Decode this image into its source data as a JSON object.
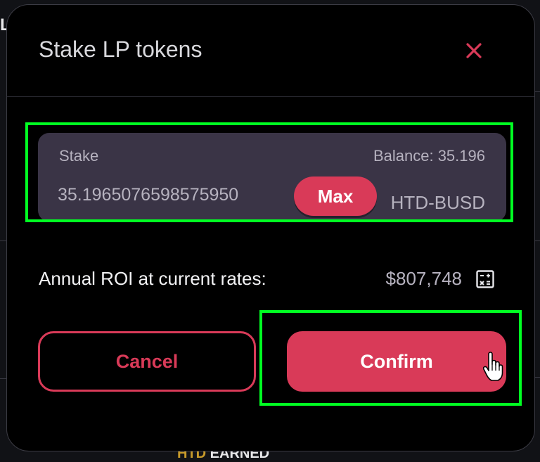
{
  "background": {
    "left_fragment": "LP",
    "bottom_fragment_highlight": "HTD",
    "bottom_fragment_text": "EARNED"
  },
  "modal": {
    "title": "Stake LP tokens",
    "close_icon": "close-icon",
    "stake": {
      "label": "Stake",
      "balance": "Balance: 35.196",
      "input_value": "35.1965076598575950",
      "max_label": "Max",
      "token": "HTD-BUSD"
    },
    "roi": {
      "label": "Annual ROI at current rates:",
      "value": "$807,748",
      "icon": "calculator-icon"
    },
    "buttons": {
      "cancel_label": "Cancel",
      "confirm_label": "Confirm"
    }
  },
  "colors": {
    "accent": "#d93a58",
    "stake_box": "#3a3446",
    "highlight": "#00ff22",
    "modal_bg": "#000000"
  }
}
